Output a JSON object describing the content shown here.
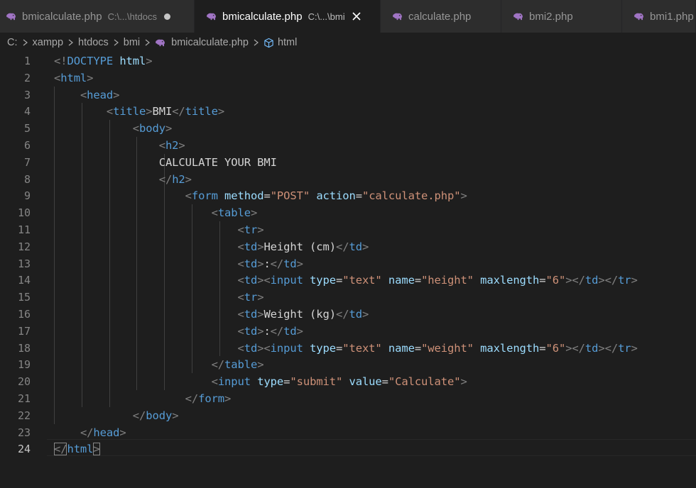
{
  "tabs": [
    {
      "name": "bmicalculate.php",
      "description": "C:\\...\\htdocs",
      "state": "dirty"
    },
    {
      "name": "bmicalculate.php",
      "description": "C:\\...\\bmi",
      "state": "active"
    },
    {
      "name": "calculate.php",
      "description": "",
      "state": ""
    },
    {
      "name": "bmi2.php",
      "description": "",
      "state": ""
    },
    {
      "name": "bmi1.php",
      "description": "",
      "state": ""
    }
  ],
  "breadcrumb": [
    "C:",
    "xampp",
    "htdocs",
    "bmi",
    "bmicalculate.php",
    "html"
  ],
  "editor": {
    "active_line": 24,
    "lines": [
      {
        "n": "1",
        "tokens": [
          [
            "p",
            "<!"
          ],
          [
            "k",
            "DOCTYPE"
          ],
          [
            "x",
            " "
          ],
          [
            "a",
            "html"
          ],
          [
            "p",
            ">"
          ]
        ]
      },
      {
        "n": "2",
        "tokens": [
          [
            "p",
            "<"
          ],
          [
            "k",
            "html"
          ],
          [
            "p",
            ">"
          ]
        ]
      },
      {
        "n": "3",
        "tokens": [
          [
            "x",
            "    "
          ],
          [
            "p",
            "<"
          ],
          [
            "k",
            "head"
          ],
          [
            "p",
            ">"
          ]
        ]
      },
      {
        "n": "4",
        "tokens": [
          [
            "x",
            "        "
          ],
          [
            "p",
            "<"
          ],
          [
            "k",
            "title"
          ],
          [
            "p",
            ">"
          ],
          [
            "x",
            "BMI"
          ],
          [
            "p",
            "</"
          ],
          [
            "k",
            "title"
          ],
          [
            "p",
            ">"
          ]
        ]
      },
      {
        "n": "5",
        "tokens": [
          [
            "x",
            "            "
          ],
          [
            "p",
            "<"
          ],
          [
            "k",
            "body"
          ],
          [
            "p",
            ">"
          ]
        ]
      },
      {
        "n": "6",
        "tokens": [
          [
            "x",
            "                "
          ],
          [
            "p",
            "<"
          ],
          [
            "k",
            "h2"
          ],
          [
            "p",
            ">"
          ]
        ]
      },
      {
        "n": "7",
        "tokens": [
          [
            "x",
            "                CALCULATE YOUR BMI"
          ]
        ]
      },
      {
        "n": "8",
        "tokens": [
          [
            "x",
            "                "
          ],
          [
            "p",
            "</"
          ],
          [
            "k",
            "h2"
          ],
          [
            "p",
            ">"
          ]
        ]
      },
      {
        "n": "9",
        "tokens": [
          [
            "x",
            "                    "
          ],
          [
            "p",
            "<"
          ],
          [
            "k",
            "form"
          ],
          [
            "x",
            " "
          ],
          [
            "a",
            "method"
          ],
          [
            "x",
            "="
          ],
          [
            "s",
            "\"POST\""
          ],
          [
            "x",
            " "
          ],
          [
            "a",
            "action"
          ],
          [
            "x",
            "="
          ],
          [
            "s",
            "\"calculate.php\""
          ],
          [
            "p",
            ">"
          ]
        ]
      },
      {
        "n": "10",
        "tokens": [
          [
            "x",
            "                        "
          ],
          [
            "p",
            "<"
          ],
          [
            "k",
            "table"
          ],
          [
            "p",
            ">"
          ]
        ]
      },
      {
        "n": "11",
        "tokens": [
          [
            "x",
            "                            "
          ],
          [
            "p",
            "<"
          ],
          [
            "k",
            "tr"
          ],
          [
            "p",
            ">"
          ]
        ]
      },
      {
        "n": "12",
        "tokens": [
          [
            "x",
            "                            "
          ],
          [
            "p",
            "<"
          ],
          [
            "k",
            "td"
          ],
          [
            "p",
            ">"
          ],
          [
            "x",
            "Height (cm)"
          ],
          [
            "p",
            "</"
          ],
          [
            "k",
            "td"
          ],
          [
            "p",
            ">"
          ]
        ]
      },
      {
        "n": "13",
        "tokens": [
          [
            "x",
            "                            "
          ],
          [
            "p",
            "<"
          ],
          [
            "k",
            "td"
          ],
          [
            "p",
            ">"
          ],
          [
            "x",
            ":"
          ],
          [
            "p",
            "</"
          ],
          [
            "k",
            "td"
          ],
          [
            "p",
            ">"
          ]
        ]
      },
      {
        "n": "14",
        "tokens": [
          [
            "x",
            "                            "
          ],
          [
            "p",
            "<"
          ],
          [
            "k",
            "td"
          ],
          [
            "p",
            "><"
          ],
          [
            "k",
            "input"
          ],
          [
            "x",
            " "
          ],
          [
            "a",
            "type"
          ],
          [
            "x",
            "="
          ],
          [
            "s",
            "\"text\""
          ],
          [
            "x",
            " "
          ],
          [
            "a",
            "name"
          ],
          [
            "x",
            "="
          ],
          [
            "s",
            "\"height\""
          ],
          [
            "x",
            " "
          ],
          [
            "a",
            "maxlength"
          ],
          [
            "x",
            "="
          ],
          [
            "s",
            "\"6\""
          ],
          [
            "p",
            "></"
          ],
          [
            "k",
            "td"
          ],
          [
            "p",
            "></"
          ],
          [
            "k",
            "tr"
          ],
          [
            "p",
            ">"
          ]
        ]
      },
      {
        "n": "15",
        "tokens": [
          [
            "x",
            "                            "
          ],
          [
            "p",
            "<"
          ],
          [
            "k",
            "tr"
          ],
          [
            "p",
            ">"
          ]
        ]
      },
      {
        "n": "16",
        "tokens": [
          [
            "x",
            "                            "
          ],
          [
            "p",
            "<"
          ],
          [
            "k",
            "td"
          ],
          [
            "p",
            ">"
          ],
          [
            "x",
            "Weight (kg)"
          ],
          [
            "p",
            "</"
          ],
          [
            "k",
            "td"
          ],
          [
            "p",
            ">"
          ]
        ]
      },
      {
        "n": "17",
        "tokens": [
          [
            "x",
            "                            "
          ],
          [
            "p",
            "<"
          ],
          [
            "k",
            "td"
          ],
          [
            "p",
            ">"
          ],
          [
            "x",
            ":"
          ],
          [
            "p",
            "</"
          ],
          [
            "k",
            "td"
          ],
          [
            "p",
            ">"
          ]
        ]
      },
      {
        "n": "18",
        "tokens": [
          [
            "x",
            "                            "
          ],
          [
            "p",
            "<"
          ],
          [
            "k",
            "td"
          ],
          [
            "p",
            "><"
          ],
          [
            "k",
            "input"
          ],
          [
            "x",
            " "
          ],
          [
            "a",
            "type"
          ],
          [
            "x",
            "="
          ],
          [
            "s",
            "\"text\""
          ],
          [
            "x",
            " "
          ],
          [
            "a",
            "name"
          ],
          [
            "x",
            "="
          ],
          [
            "s",
            "\"weight\""
          ],
          [
            "x",
            " "
          ],
          [
            "a",
            "maxlength"
          ],
          [
            "x",
            "="
          ],
          [
            "s",
            "\"6\""
          ],
          [
            "p",
            "></"
          ],
          [
            "k",
            "td"
          ],
          [
            "p",
            "></"
          ],
          [
            "k",
            "tr"
          ],
          [
            "p",
            ">"
          ]
        ]
      },
      {
        "n": "19",
        "tokens": [
          [
            "x",
            "                        "
          ],
          [
            "p",
            "</"
          ],
          [
            "k",
            "table"
          ],
          [
            "p",
            ">"
          ]
        ]
      },
      {
        "n": "20",
        "tokens": [
          [
            "x",
            "                        "
          ],
          [
            "p",
            "<"
          ],
          [
            "k",
            "input"
          ],
          [
            "x",
            " "
          ],
          [
            "a",
            "type"
          ],
          [
            "x",
            "="
          ],
          [
            "s",
            "\"submit\""
          ],
          [
            "x",
            " "
          ],
          [
            "a",
            "value"
          ],
          [
            "x",
            "="
          ],
          [
            "s",
            "\"Calculate\""
          ],
          [
            "p",
            ">"
          ]
        ]
      },
      {
        "n": "21",
        "tokens": [
          [
            "x",
            "                    "
          ],
          [
            "p",
            "</"
          ],
          [
            "k",
            "form"
          ],
          [
            "p",
            ">"
          ]
        ]
      },
      {
        "n": "22",
        "tokens": [
          [
            "x",
            "            "
          ],
          [
            "p",
            "</"
          ],
          [
            "k",
            "body"
          ],
          [
            "p",
            ">"
          ]
        ]
      },
      {
        "n": "23",
        "tokens": [
          [
            "x",
            "    "
          ],
          [
            "p",
            "</"
          ],
          [
            "k",
            "head"
          ],
          [
            "p",
            ">"
          ]
        ]
      },
      {
        "n": "24",
        "tokens": [
          [
            "p",
            "</"
          ],
          [
            "k",
            "html"
          ],
          [
            "p",
            ">"
          ]
        ]
      }
    ]
  },
  "colors": {
    "background": "#1e1e1e",
    "tag_bracket": "#808080",
    "tag_name": "#569cd6",
    "attribute": "#9cdcfe",
    "string": "#ce9178",
    "text": "#d4d4d4",
    "php_icon": "#a074c4"
  },
  "icons": [
    "php-elephant-icon",
    "close-icon",
    "dirty-dot-icon",
    "chevron-right-icon",
    "cube-icon"
  ]
}
